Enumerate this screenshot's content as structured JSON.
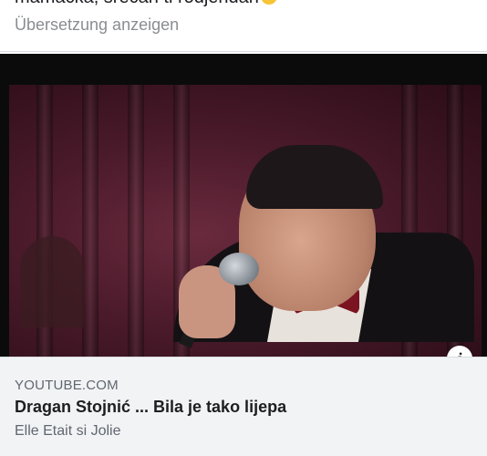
{
  "post": {
    "text": "mamacka, srecan ti rodjendan",
    "translate_label": "Übersetzung anzeigen"
  },
  "link_preview": {
    "domain": "YOUTUBE.COM",
    "title": "Dragan Stojnić ... Bila je tako lijepa",
    "subtitle": "Elle Etait si Jolie",
    "info_icon": "info-icon"
  },
  "colors": {
    "meta_background": "#f2f3f5",
    "muted_text": "#606770",
    "primary_text": "#1c1e21"
  }
}
